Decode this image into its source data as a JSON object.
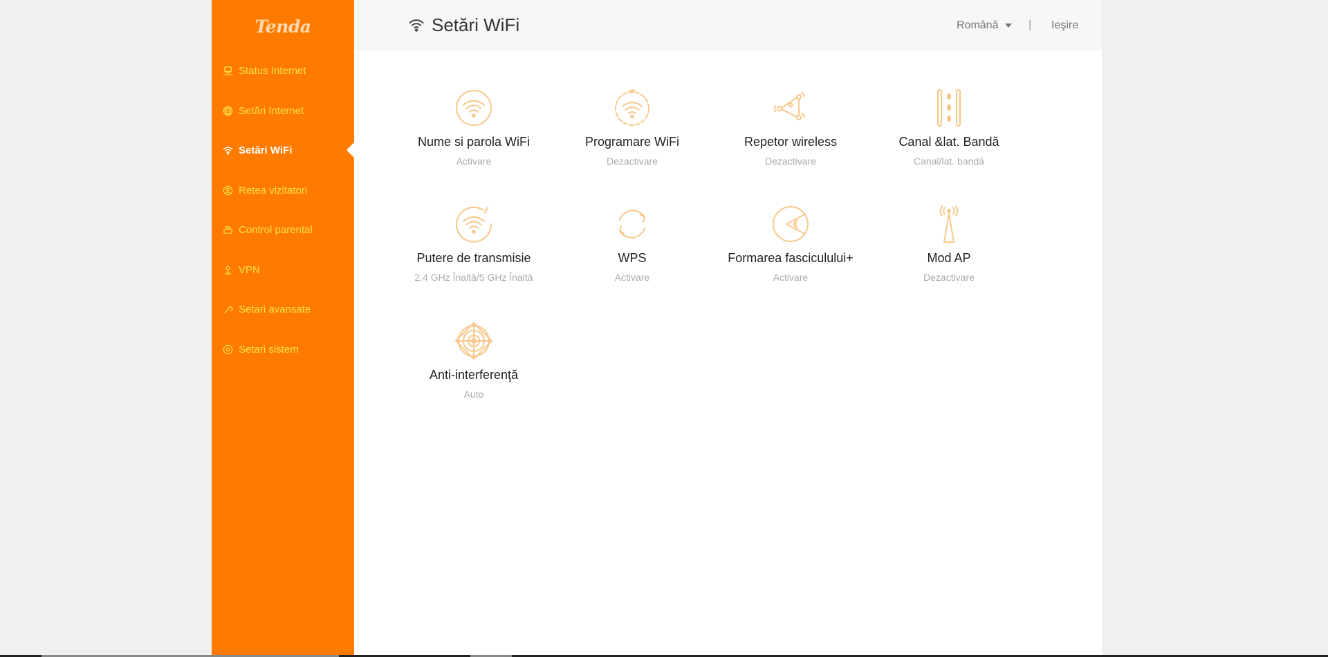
{
  "sidebar": {
    "logo": "Tenda",
    "items": [
      {
        "label": "Status Internet",
        "icon": "network-status-icon",
        "active": false
      },
      {
        "label": "Setări Internet",
        "icon": "globe-icon",
        "active": false
      },
      {
        "label": "Setări WiFi",
        "icon": "wifi-icon",
        "active": true
      },
      {
        "label": "Retea vizitatori",
        "icon": "guest-network-icon",
        "active": false
      },
      {
        "label": "Control parental",
        "icon": "parental-control-icon",
        "active": false
      },
      {
        "label": "VPN",
        "icon": "vpn-icon",
        "active": false
      },
      {
        "label": "Setari avansate",
        "icon": "wrench-icon",
        "active": false
      },
      {
        "label": "Setari sistem",
        "icon": "gear-icon",
        "active": false
      }
    ]
  },
  "header": {
    "title": "Setări WiFi",
    "title_icon": "wifi-icon",
    "language": "Română",
    "separator": "|",
    "logout": "Ieşire"
  },
  "tiles": [
    {
      "title": "Nume si parola WiFi",
      "status": "Activare",
      "icon": "wifi-circle-icon"
    },
    {
      "title": "Programare WiFi",
      "status": "Dezactivare",
      "icon": "wifi-schedule-icon"
    },
    {
      "title": "Repetor wireless",
      "status": "Dezactivare",
      "icon": "repeater-icon"
    },
    {
      "title": "Canal &lat. Bandă",
      "status": "Canal/lat. bandă",
      "icon": "channel-icon"
    },
    {
      "title": "Putere de transmisie",
      "status": "2.4 GHz Înaltă/5 GHz Înaltă",
      "icon": "transmit-power-icon"
    },
    {
      "title": "WPS",
      "status": "Activare",
      "icon": "wps-icon"
    },
    {
      "title": "Formarea fasciculului+",
      "status": "Activare",
      "icon": "beamforming-icon"
    },
    {
      "title": "Mod AP",
      "status": "Dezactivare",
      "icon": "antenna-icon"
    },
    {
      "title": "Anti-interferenţă",
      "status": "Auto",
      "icon": "anti-interference-icon"
    }
  ],
  "colors": {
    "sidebar_bg": "#ff7b00",
    "nav_text": "#ffe04a",
    "nav_active": "#ffffff",
    "tile_icon": "#f8c78a"
  }
}
